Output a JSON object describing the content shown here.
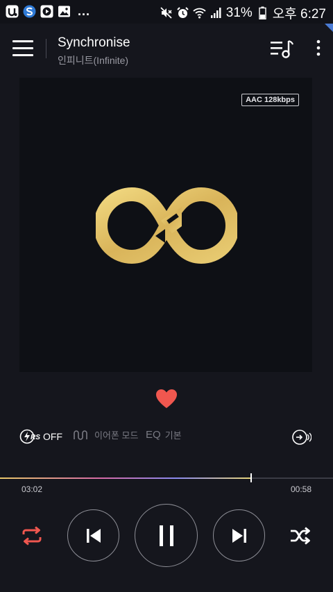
{
  "status_bar": {
    "notification_icons": [
      "app-u-icon",
      "browser-s-icon",
      "video-play-icon",
      "image-icon"
    ],
    "overflow": "...",
    "battery": "31%",
    "time": "오후 6:27",
    "icons": [
      "mute-icon",
      "alarm-icon",
      "wifi-icon",
      "signal-icon",
      "battery-icon"
    ]
  },
  "header": {
    "title": "Synchronise",
    "artist": "인피니트(Infinite)",
    "icons": [
      "menu-icon",
      "playlist-icon",
      "more-icon"
    ]
  },
  "album": {
    "quality": "AAC 128kbps",
    "logo": "infinite-logo",
    "logo_color": "#e3c56b"
  },
  "favorite": {
    "icon": "heart-icon",
    "color": "#f0574f"
  },
  "sound_options": {
    "rs_label": "OFF",
    "earphone_label": "이어폰 모드",
    "eq_label": "EQ",
    "eq_value": "기본"
  },
  "progress": {
    "current": "03:02",
    "remaining": "00:58",
    "fraction": 0.755
  },
  "controls": {
    "accent": "#f0574f",
    "icons": [
      "repeat-icon",
      "previous-icon",
      "pause-icon",
      "next-icon",
      "shuffle-icon"
    ]
  }
}
